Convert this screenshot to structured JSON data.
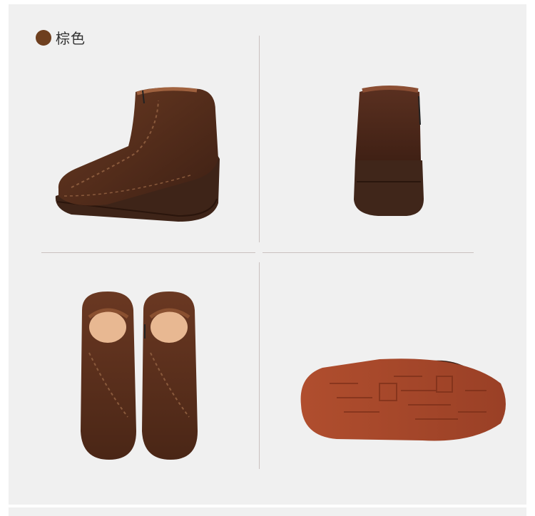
{
  "color_option": {
    "label": "棕色",
    "swatch_color": "#6e3f1f"
  },
  "views": [
    {
      "name": "side-view",
      "icon": "boot-side-image"
    },
    {
      "name": "back-view",
      "icon": "boot-back-image"
    },
    {
      "name": "top-view",
      "icon": "boots-top-pair-image"
    },
    {
      "name": "sole-view",
      "icon": "boot-sole-image"
    }
  ],
  "colors": {
    "background": "#f0f0f0",
    "leather": "#5a2f1c",
    "leather_dark": "#3d1e12",
    "sole_rust": "#a54b2c",
    "divider": "#c9c0bf"
  }
}
